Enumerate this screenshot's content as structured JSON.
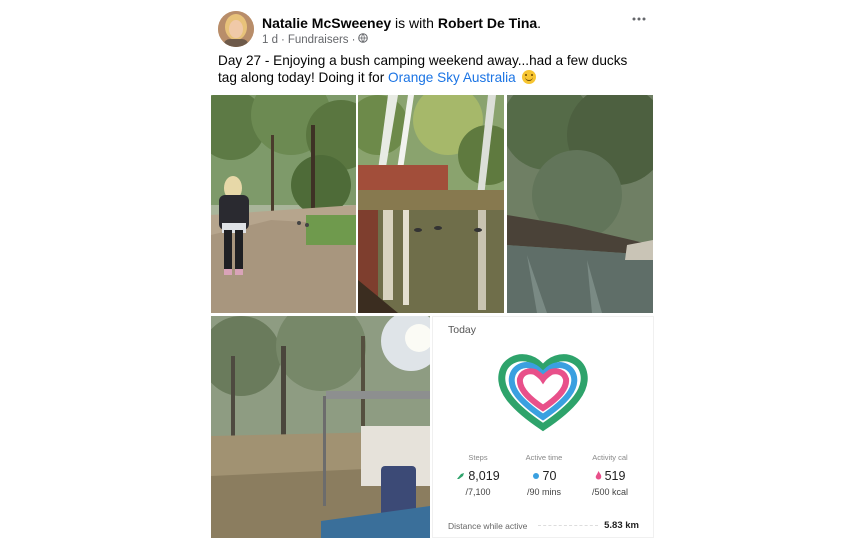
{
  "post": {
    "author": "Natalie McSweeney",
    "with_text": " is with ",
    "tagged": "Robert De Tina",
    "period": ".",
    "time": "1 d",
    "separator": "·",
    "category": "Fundraisers",
    "separator2": "·",
    "body_text": "Day 27 - Enjoying a bush camping weekend away...had a few ducks tag along today! Doing it for ",
    "link_text": "Orange Sky Australia",
    "more_icon": "more-options-icon",
    "privacy_icon": "globe-icon"
  },
  "activity": {
    "today_label": "Today",
    "steps": {
      "label": "Steps",
      "value": "8,019",
      "goal": "/7,100",
      "color": "#2ea36b"
    },
    "active_time": {
      "label": "Active time",
      "value": "70",
      "goal": "/90 mins",
      "color": "#3aa0e0"
    },
    "activity_cal": {
      "label": "Activity cal",
      "value": "519",
      "goal": "/500 kcal",
      "color": "#e8508a"
    },
    "distance_label": "Distance while active",
    "distance_value": "5.83 km"
  },
  "photos": [
    {
      "name": "walking-path-photo"
    },
    {
      "name": "ducks-water-photo"
    },
    {
      "name": "riverbank-photo"
    },
    {
      "name": "campsite-photo"
    }
  ]
}
